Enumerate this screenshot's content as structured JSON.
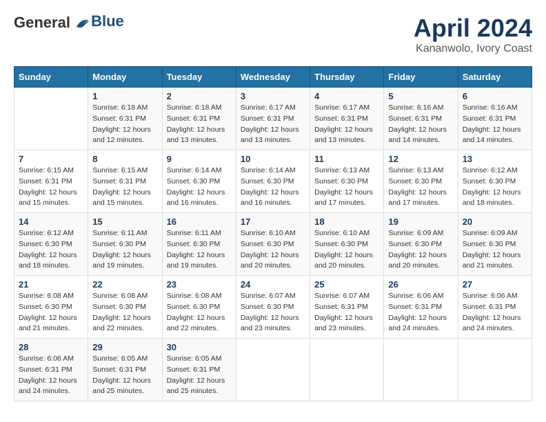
{
  "header": {
    "logo_line1": "General",
    "logo_line2": "Blue",
    "title": "April 2024",
    "subtitle": "Kananwolo, Ivory Coast"
  },
  "days_of_week": [
    "Sunday",
    "Monday",
    "Tuesday",
    "Wednesday",
    "Thursday",
    "Friday",
    "Saturday"
  ],
  "weeks": [
    [
      {
        "day": "",
        "sunrise": "",
        "sunset": "",
        "daylight": ""
      },
      {
        "day": "1",
        "sunrise": "6:18 AM",
        "sunset": "6:31 PM",
        "daylight": "12 hours and 12 minutes."
      },
      {
        "day": "2",
        "sunrise": "6:18 AM",
        "sunset": "6:31 PM",
        "daylight": "12 hours and 13 minutes."
      },
      {
        "day": "3",
        "sunrise": "6:17 AM",
        "sunset": "6:31 PM",
        "daylight": "12 hours and 13 minutes."
      },
      {
        "day": "4",
        "sunrise": "6:17 AM",
        "sunset": "6:31 PM",
        "daylight": "12 hours and 13 minutes."
      },
      {
        "day": "5",
        "sunrise": "6:16 AM",
        "sunset": "6:31 PM",
        "daylight": "12 hours and 14 minutes."
      },
      {
        "day": "6",
        "sunrise": "6:16 AM",
        "sunset": "6:31 PM",
        "daylight": "12 hours and 14 minutes."
      }
    ],
    [
      {
        "day": "7",
        "sunrise": "6:15 AM",
        "sunset": "6:31 PM",
        "daylight": "12 hours and 15 minutes."
      },
      {
        "day": "8",
        "sunrise": "6:15 AM",
        "sunset": "6:31 PM",
        "daylight": "12 hours and 15 minutes."
      },
      {
        "day": "9",
        "sunrise": "6:14 AM",
        "sunset": "6:30 PM",
        "daylight": "12 hours and 16 minutes."
      },
      {
        "day": "10",
        "sunrise": "6:14 AM",
        "sunset": "6:30 PM",
        "daylight": "12 hours and 16 minutes."
      },
      {
        "day": "11",
        "sunrise": "6:13 AM",
        "sunset": "6:30 PM",
        "daylight": "12 hours and 17 minutes."
      },
      {
        "day": "12",
        "sunrise": "6:13 AM",
        "sunset": "6:30 PM",
        "daylight": "12 hours and 17 minutes."
      },
      {
        "day": "13",
        "sunrise": "6:12 AM",
        "sunset": "6:30 PM",
        "daylight": "12 hours and 18 minutes."
      }
    ],
    [
      {
        "day": "14",
        "sunrise": "6:12 AM",
        "sunset": "6:30 PM",
        "daylight": "12 hours and 18 minutes."
      },
      {
        "day": "15",
        "sunrise": "6:11 AM",
        "sunset": "6:30 PM",
        "daylight": "12 hours and 19 minutes."
      },
      {
        "day": "16",
        "sunrise": "6:11 AM",
        "sunset": "6:30 PM",
        "daylight": "12 hours and 19 minutes."
      },
      {
        "day": "17",
        "sunrise": "6:10 AM",
        "sunset": "6:30 PM",
        "daylight": "12 hours and 20 minutes."
      },
      {
        "day": "18",
        "sunrise": "6:10 AM",
        "sunset": "6:30 PM",
        "daylight": "12 hours and 20 minutes."
      },
      {
        "day": "19",
        "sunrise": "6:09 AM",
        "sunset": "6:30 PM",
        "daylight": "12 hours and 20 minutes."
      },
      {
        "day": "20",
        "sunrise": "6:09 AM",
        "sunset": "6:30 PM",
        "daylight": "12 hours and 21 minutes."
      }
    ],
    [
      {
        "day": "21",
        "sunrise": "6:08 AM",
        "sunset": "6:30 PM",
        "daylight": "12 hours and 21 minutes."
      },
      {
        "day": "22",
        "sunrise": "6:08 AM",
        "sunset": "6:30 PM",
        "daylight": "12 hours and 22 minutes."
      },
      {
        "day": "23",
        "sunrise": "6:08 AM",
        "sunset": "6:30 PM",
        "daylight": "12 hours and 22 minutes."
      },
      {
        "day": "24",
        "sunrise": "6:07 AM",
        "sunset": "6:30 PM",
        "daylight": "12 hours and 23 minutes."
      },
      {
        "day": "25",
        "sunrise": "6:07 AM",
        "sunset": "6:31 PM",
        "daylight": "12 hours and 23 minutes."
      },
      {
        "day": "26",
        "sunrise": "6:06 AM",
        "sunset": "6:31 PM",
        "daylight": "12 hours and 24 minutes."
      },
      {
        "day": "27",
        "sunrise": "6:06 AM",
        "sunset": "6:31 PM",
        "daylight": "12 hours and 24 minutes."
      }
    ],
    [
      {
        "day": "28",
        "sunrise": "6:06 AM",
        "sunset": "6:31 PM",
        "daylight": "12 hours and 24 minutes."
      },
      {
        "day": "29",
        "sunrise": "6:05 AM",
        "sunset": "6:31 PM",
        "daylight": "12 hours and 25 minutes."
      },
      {
        "day": "30",
        "sunrise": "6:05 AM",
        "sunset": "6:31 PM",
        "daylight": "12 hours and 25 minutes."
      },
      {
        "day": "",
        "sunrise": "",
        "sunset": "",
        "daylight": ""
      },
      {
        "day": "",
        "sunrise": "",
        "sunset": "",
        "daylight": ""
      },
      {
        "day": "",
        "sunrise": "",
        "sunset": "",
        "daylight": ""
      },
      {
        "day": "",
        "sunrise": "",
        "sunset": "",
        "daylight": ""
      }
    ]
  ]
}
